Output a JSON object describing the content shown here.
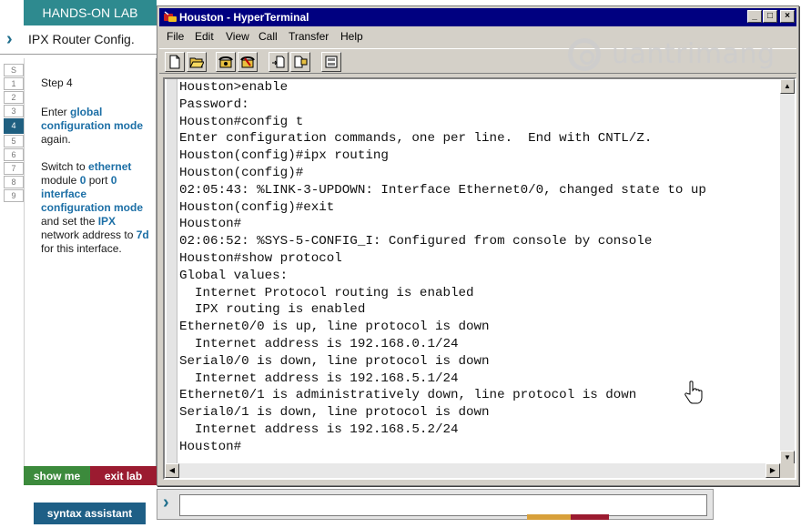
{
  "lab": {
    "header": "HANDS-ON LAB",
    "title": "IPX Router Config.",
    "step_tabs": [
      "S",
      "1",
      "2",
      "3",
      "4",
      "5",
      "6",
      "7",
      "8",
      "9"
    ],
    "active_step": "4",
    "step_label": "Step 4",
    "instruction1": {
      "pre": "Enter ",
      "hl": "global configuration mode",
      "post": " again."
    },
    "instruction2": {
      "t1": "Switch to ",
      "h1": "ethernet",
      "t2": " module ",
      "h2": "0",
      "t3": " port ",
      "h3": "0",
      "t4": " ",
      "h4": "interface configuration mode",
      "t5": " and set the ",
      "h5": "IPX",
      "t6": " network address to ",
      "h6": "7d",
      "t7": " for this interface."
    },
    "show_me": "show me",
    "exit_lab": "exit lab",
    "syntax_assistant": "syntax assistant"
  },
  "window": {
    "title": "Houston - HyperTerminal",
    "controls": [
      "_",
      "□",
      "×"
    ],
    "menu": [
      "File",
      "Edit",
      "View",
      "Call",
      "Transfer",
      "Help"
    ],
    "toolbar_icons": [
      "new-file-icon",
      "open-folder-icon",
      "phone-call-icon",
      "disconnect-icon",
      "send-file-icon",
      "receive-file-icon",
      "properties-icon"
    ]
  },
  "terminal": {
    "lines": [
      "Houston>enable",
      "Password:",
      "Houston#config t",
      "Enter configuration commands, one per line.  End with CNTL/Z.",
      "Houston(config)#ipx routing",
      "Houston(config)#",
      "02:05:43: %LINK-3-UPDOWN: Interface Ethernet0/0, changed state to up",
      "Houston(config)#exit",
      "Houston#",
      "02:06:52: %SYS-5-CONFIG_I: Configured from console by console",
      "Houston#show protocol",
      "Global values:",
      "  Internet Protocol routing is enabled",
      "  IPX routing is enabled",
      "Ethernet0/0 is up, line protocol is down",
      "  Internet address is 192.168.0.1/24",
      "Serial0/0 is down, line protocol is down",
      "  Internet address is 192.168.5.1/24",
      "Ethernet0/1 is administratively down, line protocol is down",
      "Serial0/1 is down, line protocol is down",
      "  Internet address is 192.168.5.2/24",
      "Houston#"
    ]
  },
  "command_bar": {
    "prompt_icon": "chevron-right-icon",
    "value": ""
  },
  "watermark": "uantrimang",
  "colors": {
    "header_teal": "#2e8a8f",
    "highlight_blue": "#1c6fa6",
    "show_me_green": "#3c8a3c",
    "exit_lab_red": "#9b1b30",
    "syntax_blue": "#1e5f86",
    "titlebar_navy": "#000080"
  }
}
